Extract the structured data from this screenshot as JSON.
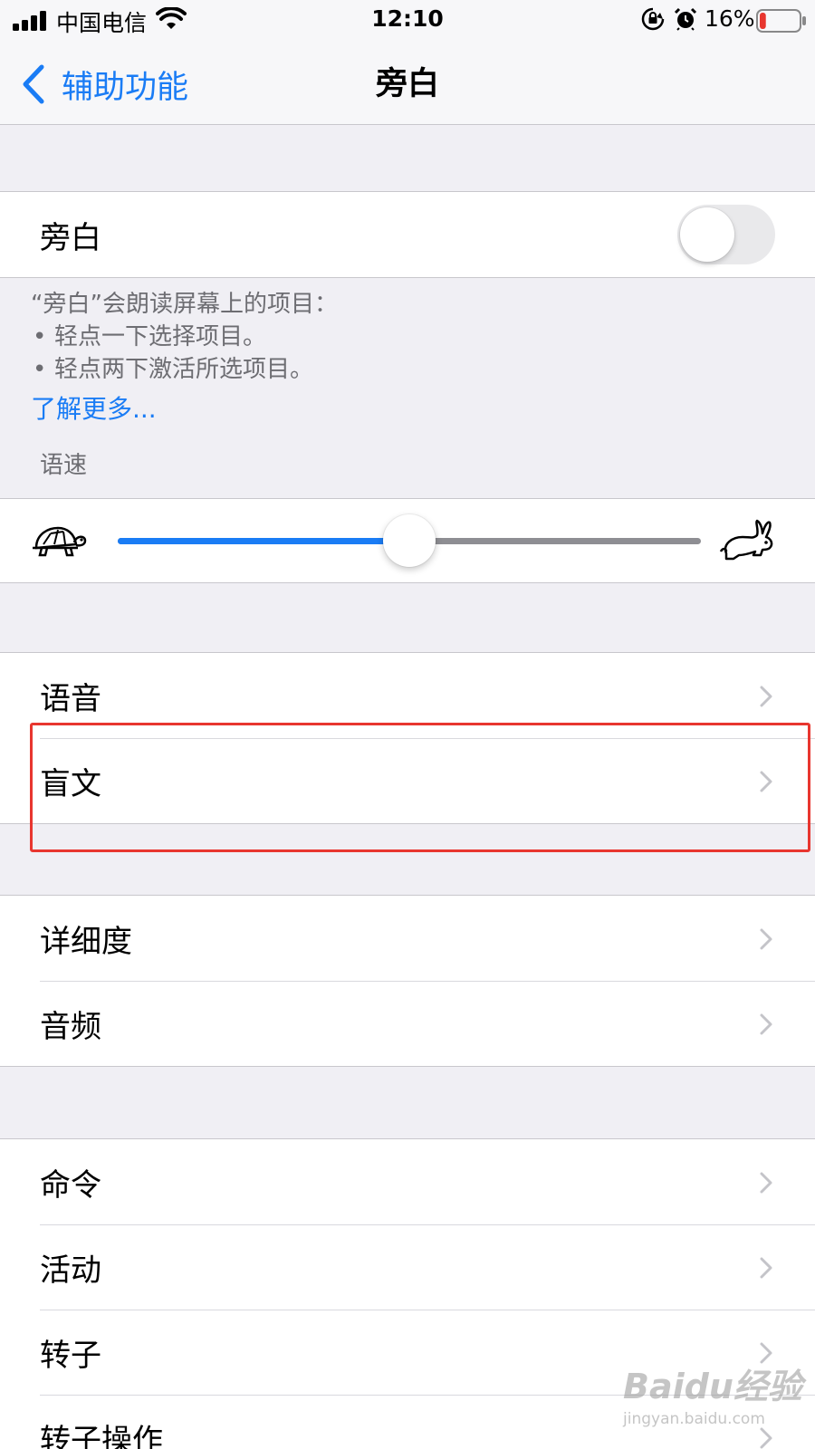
{
  "status_bar": {
    "carrier": "中国电信",
    "time": "12:10",
    "battery_percent": "16%",
    "battery_level": 0.16,
    "battery_color": "#e8362f",
    "icons": [
      "signal-icon",
      "wifi-icon",
      "orientation-lock-icon",
      "alarm-icon",
      "battery-icon"
    ]
  },
  "nav": {
    "back_label": "辅助功能",
    "title": "旁白"
  },
  "voiceover": {
    "label": "旁白",
    "toggle_on": false
  },
  "description": {
    "intro": "“旁白”会朗读屏幕上的项目：",
    "bullets": [
      "轻点一下选择项目。",
      "轻点两下激活所选项目。"
    ],
    "learn_more": "了解更多..."
  },
  "speech_rate": {
    "header": "语速",
    "value": 0.5,
    "slow_icon": "turtle-icon",
    "fast_icon": "rabbit-icon"
  },
  "group1": [
    "语音",
    "盲文"
  ],
  "group2": [
    "详细度",
    "音频"
  ],
  "group3": [
    "命令",
    "活动",
    "转子",
    "转子操作"
  ],
  "colors": {
    "accent": "#1a7cf5",
    "highlight_box": "#e8362f"
  },
  "watermark": {
    "main": "Baidu经验",
    "sub": "jingyan.baidu.com"
  }
}
